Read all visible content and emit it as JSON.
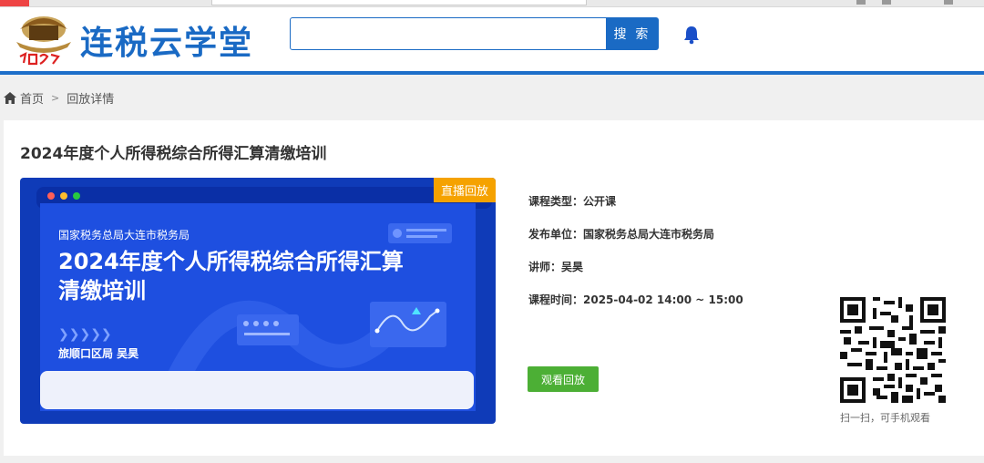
{
  "header": {
    "site_title": "连税云学堂",
    "search_placeholder": "",
    "search_label": "搜 索"
  },
  "breadcrumb": {
    "home": "首页",
    "separator": ">",
    "current": "回放详情"
  },
  "course": {
    "title": "2024年度个人所得税综合所得汇算清缴培训",
    "poster": {
      "badge": "直播回放",
      "org": "国家税务总局大连市税务局",
      "title": "2024年度个人所得税综合所得汇算清缴培训",
      "lecturer": "旅顺口区局 吴昊"
    },
    "info": {
      "type": "课程类型：公开课",
      "publisher": "发布单位：国家税务总局大连市税务局",
      "lecturer": "讲师：吴昊",
      "time": "课程时间：2025-04-02 14:00 ~ 15:00"
    },
    "watch_label": "观看回放",
    "qr_caption": "扫一扫，可手机观看"
  },
  "colors": {
    "brand": "#1a6ac4",
    "badge": "#f5a200",
    "watch": "#4caf35"
  }
}
